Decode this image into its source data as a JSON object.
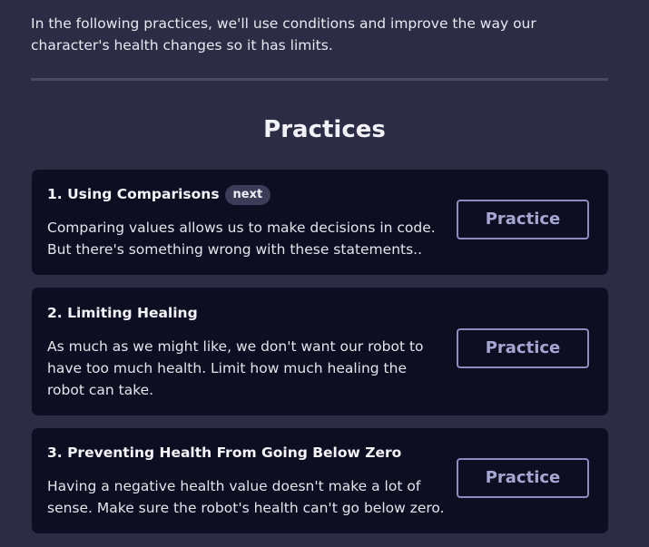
{
  "intro": {
    "text": "In the following practices, we'll use conditions and improve the way our character's health changes so it has limits."
  },
  "section": {
    "title": "Practices"
  },
  "practices": [
    {
      "title": "1. Using Comparisons",
      "badge": "next",
      "description": "Comparing values allows us to make decisions in code. But there's something wrong with these statements..",
      "button_label": "Practice"
    },
    {
      "title": "2. Limiting Healing",
      "description": "As much as we might like, we don't want our robot to have too much health. Limit how much healing the robot can take.",
      "button_label": "Practice"
    },
    {
      "title": "3. Preventing Health From Going Below Zero",
      "description": "Having a negative health value doesn't make a lot of sense. Make sure the robot's health can't go below zero.",
      "button_label": "Practice"
    }
  ]
}
